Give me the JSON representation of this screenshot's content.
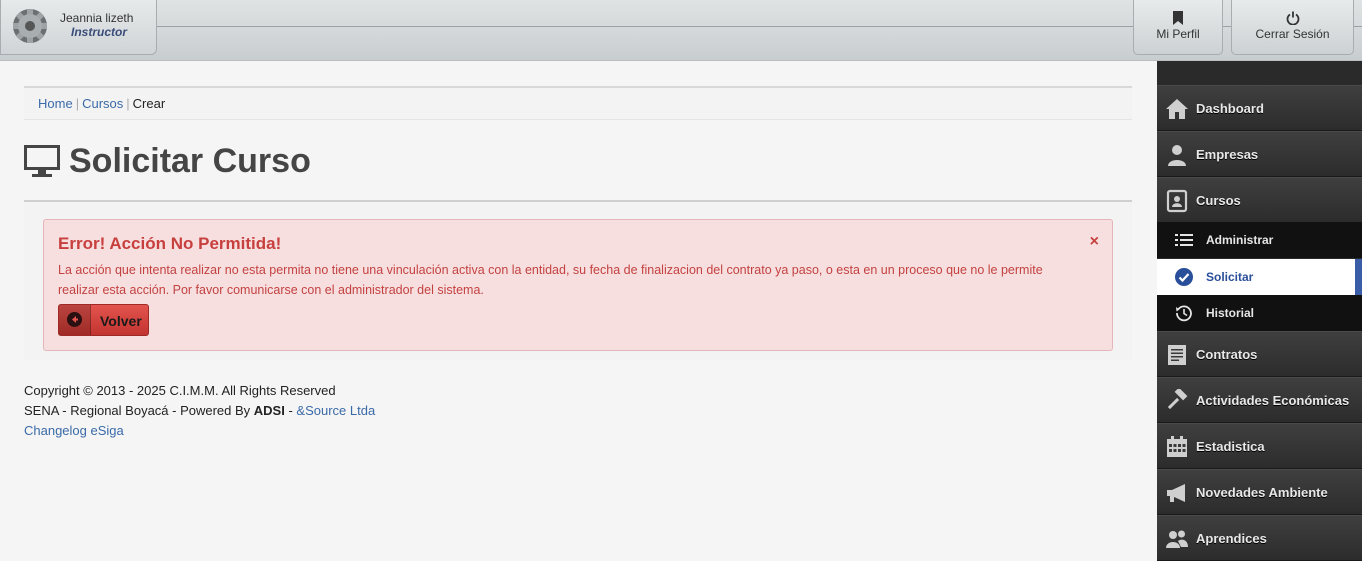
{
  "header": {
    "user_name": "Jeannia lizeth",
    "user_role": "Instructor",
    "profile_label": "Mi Perfil",
    "logout_label": "Cerrar Sesión"
  },
  "breadcrumb": {
    "home": "Home",
    "courses": "Cursos",
    "current": "Crear"
  },
  "page": {
    "title": "Solicitar Curso"
  },
  "alert": {
    "title": "Error! Acción No Permitida!",
    "close": "×",
    "message": "La acción que intenta realizar no esta permita no tiene una vinculación activa con la entidad, su fecha de finalizacion del contrato ya paso, o esta en un proceso que no le permite realizar esta acción. Por favor comunicarse con el administrador del sistema.",
    "button_label": "Volver"
  },
  "footer": {
    "copyright": "Copyright © 2013 - 2025 C.I.M.M. All Rights Reserved",
    "line2_prefix": "SENA - Regional Boyacá - Powered By ",
    "line2_bold": "ADSI",
    "line2_sep": " - ",
    "line2_link": "&Source Ltda",
    "changelog": "Changelog eSiga"
  },
  "sidebar": {
    "items": [
      {
        "label": "Dashboard",
        "icon": "home-icon"
      },
      {
        "label": "Empresas",
        "icon": "person-icon"
      },
      {
        "label": "Cursos",
        "icon": "contact-book-icon"
      },
      {
        "label": "Contratos",
        "icon": "document-icon"
      },
      {
        "label": "Actividades Económicas",
        "icon": "hammer-icon"
      },
      {
        "label": "Estadistica",
        "icon": "calendar-icon"
      },
      {
        "label": "Novedades Ambiente",
        "icon": "megaphone-icon"
      },
      {
        "label": "Aprendices",
        "icon": "users-icon"
      }
    ],
    "sub_items": [
      {
        "label": "Administrar",
        "icon": "list-icon"
      },
      {
        "label": "Solicitar",
        "icon": "check-circle-icon",
        "active": true
      },
      {
        "label": "Historial",
        "icon": "history-icon"
      }
    ]
  },
  "colors": {
    "alert_text": "#c7403e",
    "alert_bg": "#f7dfe0",
    "link": "#3a6aa8",
    "active_accent": "#3a5da8"
  }
}
